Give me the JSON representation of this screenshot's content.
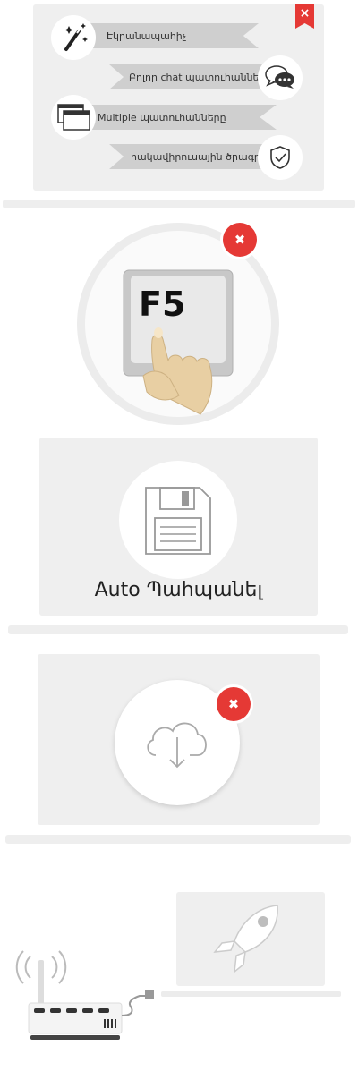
{
  "features": {
    "wizard_label": "Էկրանապահիչ",
    "all_chats_label": "Բոլոր chat պատուհանները",
    "multiple_windows_label": "Multiple պատուհանները",
    "security_label": "հակավիրուսային ծրագրեր",
    "close_glyph": "×"
  },
  "refresh": {
    "key_label": "F5",
    "close_glyph": "✖"
  },
  "autosave": {
    "label": "Auto Պահպանել"
  },
  "download": {
    "close_glyph": "✖"
  },
  "colors": {
    "panel": "#efefef",
    "ribbon": "#cfcfcf",
    "close_red": "#e53935",
    "icon_gray": "#9e9e9e"
  }
}
